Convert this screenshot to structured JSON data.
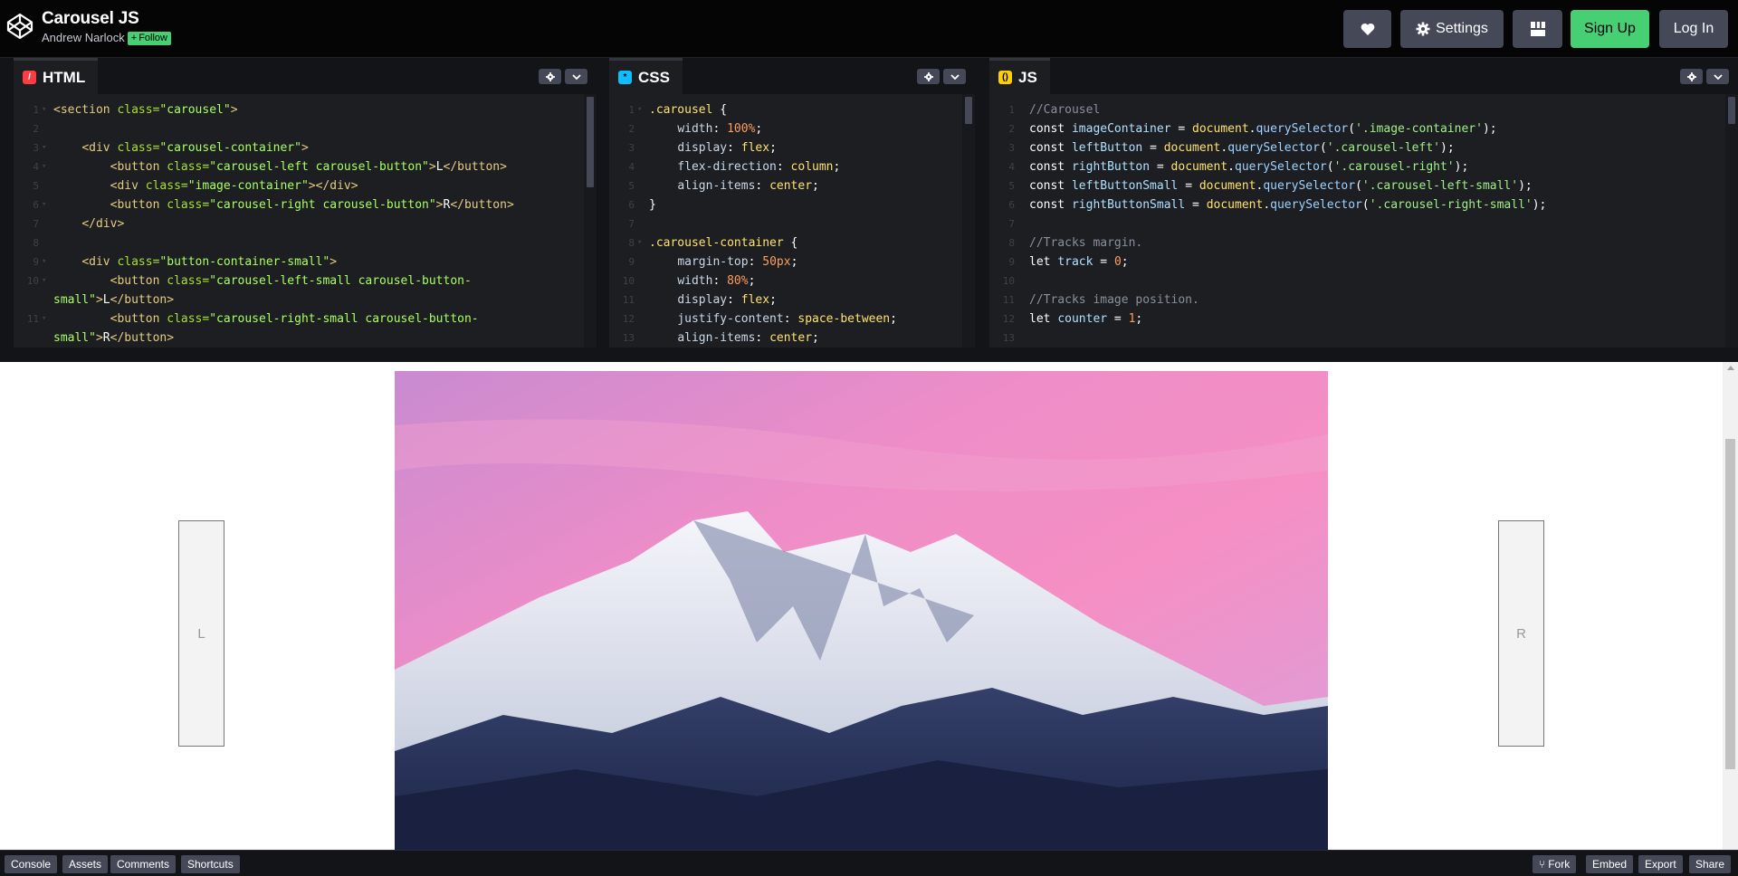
{
  "header": {
    "pen_title": "Carousel JS",
    "author": "Andrew Narlock",
    "follow_label": "Follow",
    "settings_label": "Settings",
    "signup_label": "Sign Up",
    "login_label": "Log In"
  },
  "editors": {
    "html": {
      "tab_label": "HTML"
    },
    "css": {
      "tab_label": "CSS"
    },
    "js": {
      "tab_label": "JS"
    }
  },
  "preview": {
    "left_button": "L",
    "right_button": "R"
  },
  "footer": {
    "console": "Console",
    "assets": "Assets",
    "comments": "Comments",
    "shortcuts": "Shortcuts",
    "fork": "Fork",
    "embed": "Embed",
    "export": "Export",
    "share": "Share"
  },
  "colors": {
    "accent_green": "#47cf73",
    "button_gray": "#444857",
    "html_badge": "#ff3c41",
    "css_badge": "#0ebeff",
    "js_badge": "#fcd000"
  },
  "icons": [
    "codepen-logo-icon",
    "heart-icon",
    "gear-icon",
    "layout-grid-icon",
    "fork-icon",
    "chevron-down-icon",
    "plus-icon"
  ]
}
